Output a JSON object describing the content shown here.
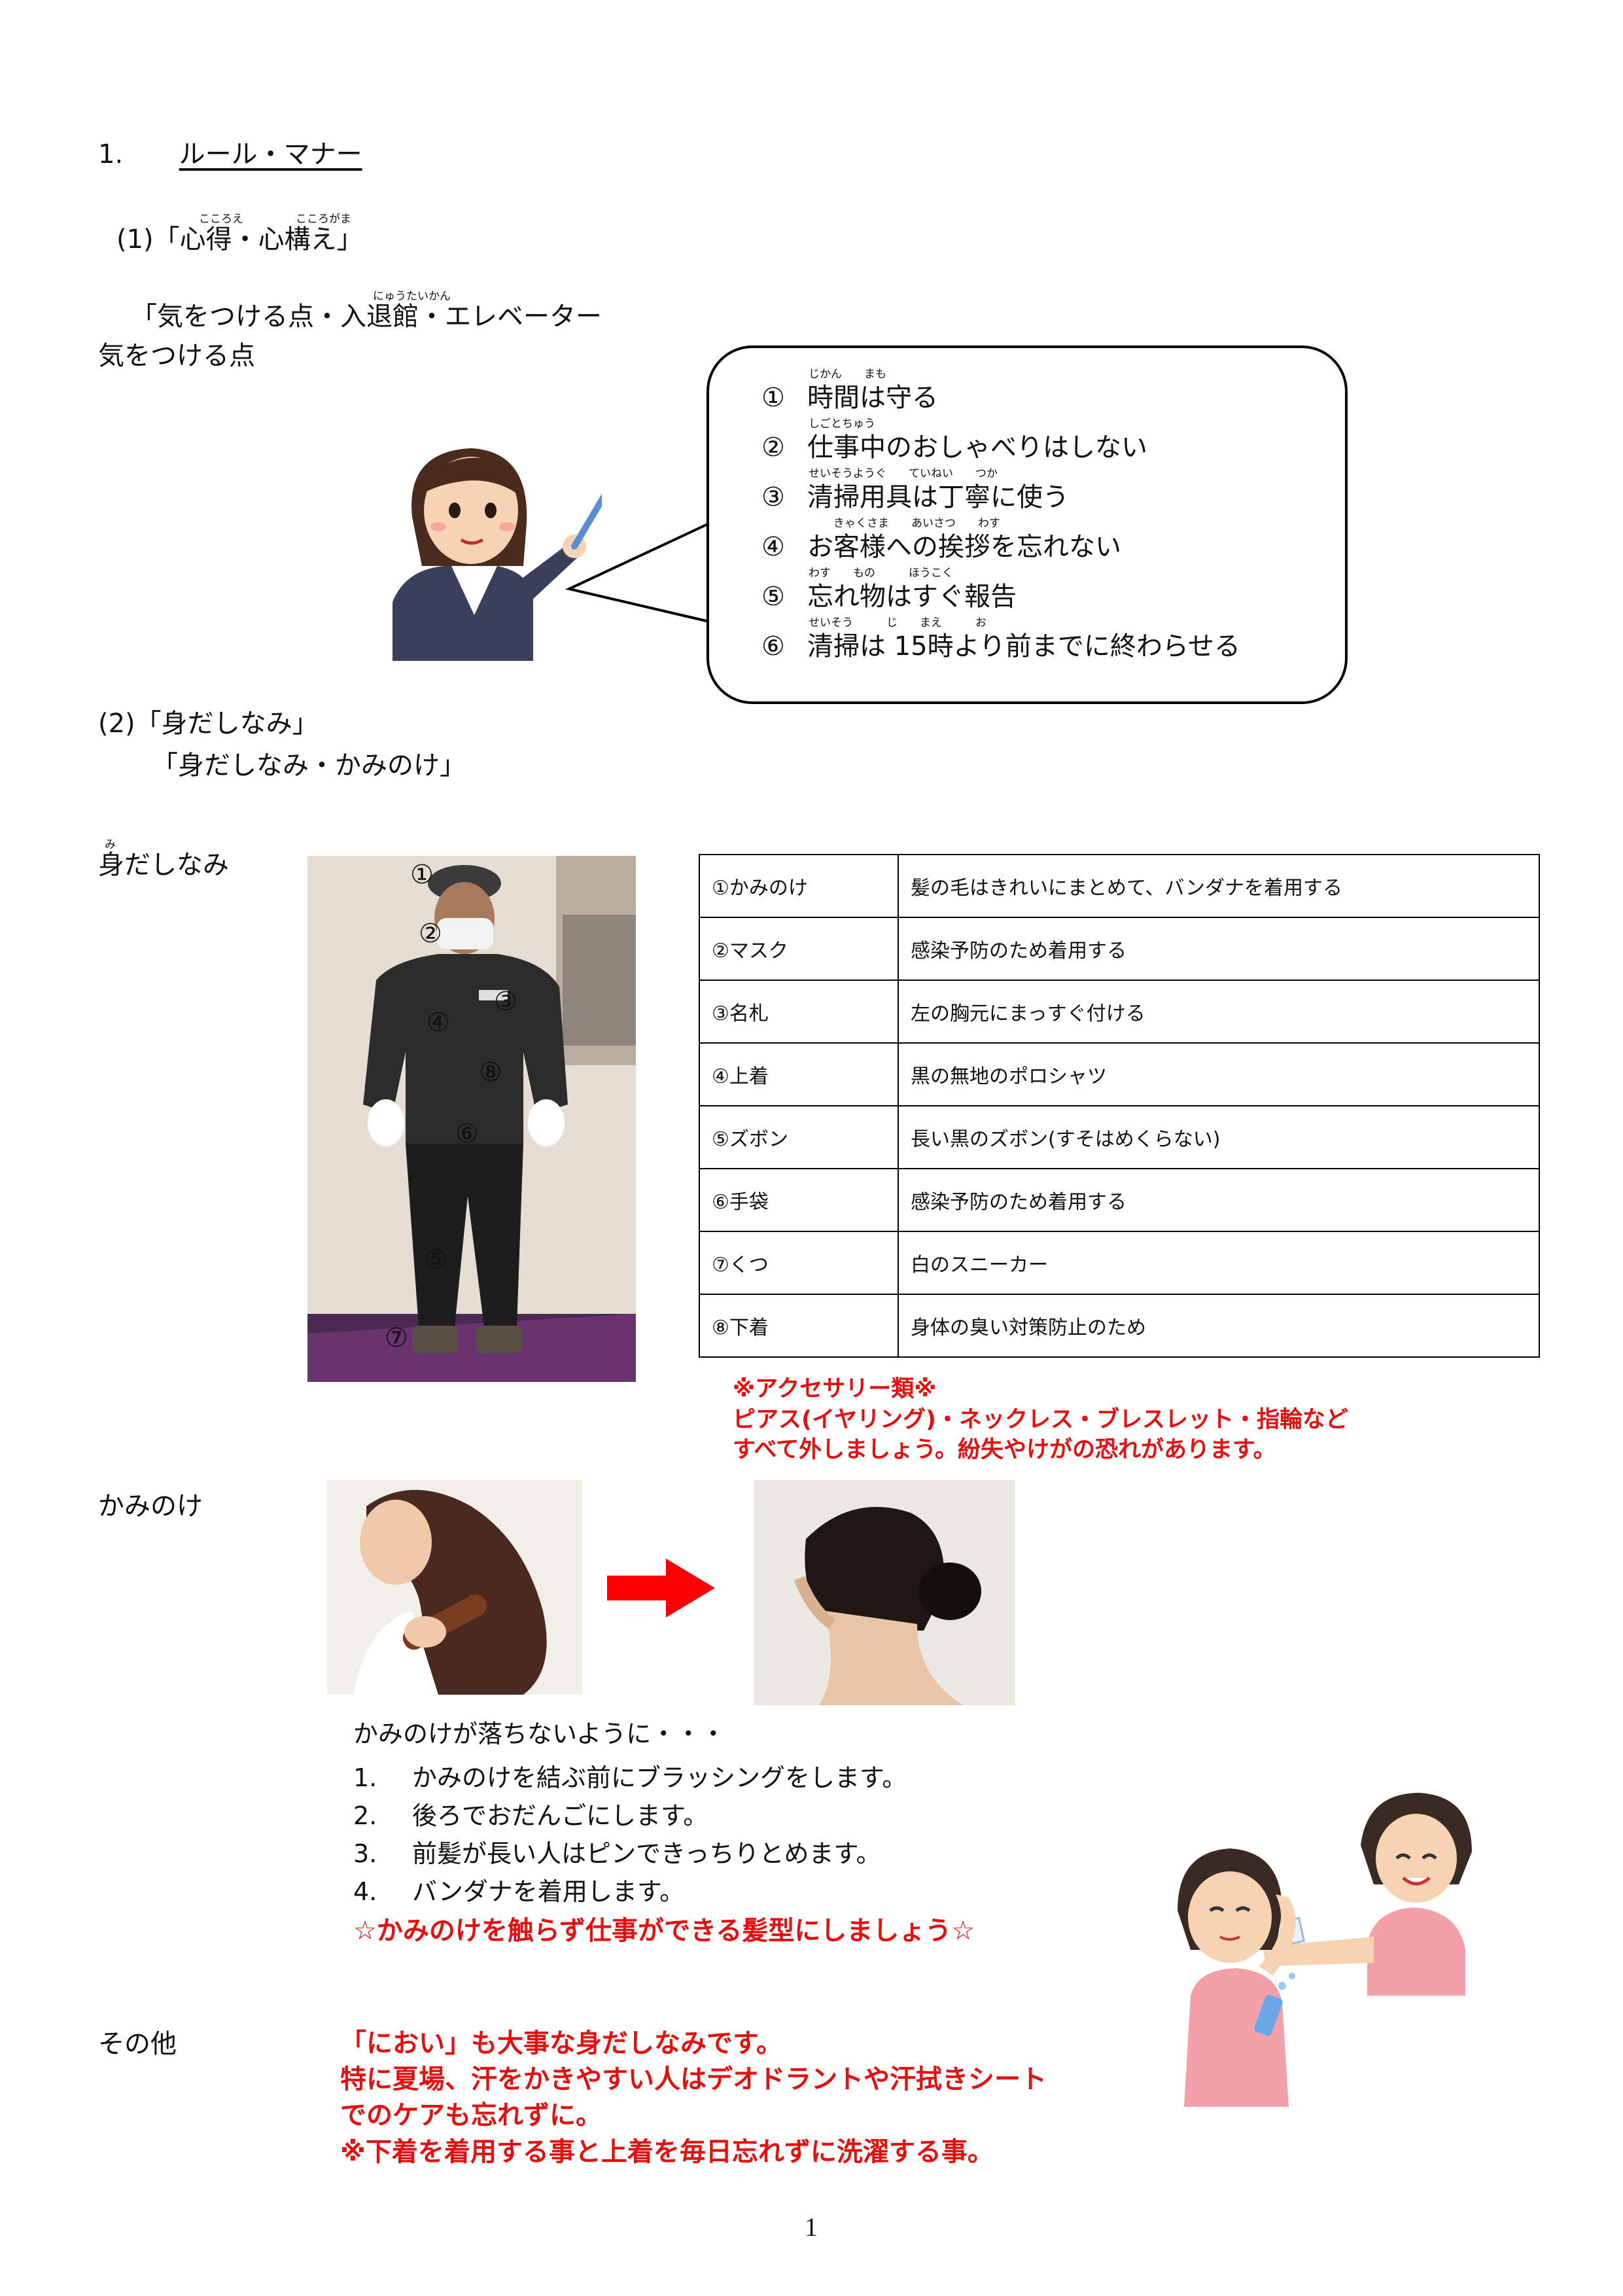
{
  "heading": {
    "num": "1.",
    "title": "ルール・マナー"
  },
  "sec1": {
    "title": "(1)「心得・心構え」",
    "ruby_kokoroe": "こころえ",
    "ruby_kokorogamae": "こころがま",
    "lead_line1": "「気をつける点・入退館・エレベーター",
    "lead_line2": "気をつける点",
    "ruby_nyuutaikan": "にゅうたいかん",
    "bubble_items": [
      {
        "num": "①",
        "text": "時間は守る",
        "ruby": "じかん　　まも"
      },
      {
        "num": "②",
        "text": "仕事中のおしゃべりはしない",
        "ruby": "しごとちゅう"
      },
      {
        "num": "③",
        "text": "清掃用具は丁寧に使う",
        "ruby": "せいそうようぐ　　ていねい　　つか"
      },
      {
        "num": "④",
        "text": "お客様への挨拶を忘れない",
        "ruby": "きゃくさま　　あいさつ　　わす"
      },
      {
        "num": "⑤",
        "text": "忘れ物はすぐ報告",
        "ruby": "わす　　もの　　　ほうこく"
      },
      {
        "num": "⑥",
        "text": "清掃は 15時より前までに終わらせる",
        "ruby": "せいそう　　　じ　　まえ　　　お"
      }
    ]
  },
  "sec2": {
    "title": "(2)「身だしなみ」",
    "subtitle": "「身だしなみ・かみのけ」",
    "label_midashinami": "身だしなみ",
    "ruby_mi": "み",
    "photo_markers": [
      "①",
      "②",
      "③",
      "④",
      "⑧",
      "⑥",
      "⑤",
      "⑦"
    ],
    "table": [
      {
        "item": "①かみのけ",
        "desc": "髪の毛はきれいにまとめて、バンダナを着用する"
      },
      {
        "item": "②マスク",
        "desc": "感染予防のため着用する"
      },
      {
        "item": "③名札",
        "desc": "左の胸元にまっすぐ付ける"
      },
      {
        "item": "④上着",
        "desc": "黒の無地のポロシャツ"
      },
      {
        "item": "⑤ズボン",
        "desc": "長い黒のズボン(すそはめくらない)"
      },
      {
        "item": "⑥手袋",
        "desc": "感染予防のため着用する"
      },
      {
        "item": "⑦くつ",
        "desc": "白のスニーカー"
      },
      {
        "item": "⑧下着",
        "desc": "身体の臭い対策防止のため"
      }
    ],
    "accessory_note": [
      "※アクセサリー類※",
      "ピアス(イヤリング)・ネックレス・ブレスレット・指輪など",
      "すべて外しましょう。紛失やけがの恐れがあります。"
    ]
  },
  "hair": {
    "label": "かみのけ",
    "intro": "かみのけが落ちないように・・・",
    "steps": [
      {
        "n": "1.",
        "text": "かみのけを結ぶ前にブラッシングをします。"
      },
      {
        "n": "2.",
        "text": "後ろでおだんごにします。"
      },
      {
        "n": "3.",
        "text": "前髪が長い人はピンできっちりとめます。"
      },
      {
        "n": "4.",
        "text": "バンダナを着用します。"
      }
    ],
    "highlight": "☆かみのけを触らず仕事ができる髪型にしましょう☆"
  },
  "other": {
    "label": "その他",
    "lines": [
      "「におい」も大事な身だしなみです。",
      "特に夏場、汗をかきやすい人はデオドラントや汗拭きシート",
      "でのケアも忘れずに。",
      "※下着を着用する事と上着を毎日忘れずに洗濯する事。"
    ]
  },
  "page_number": "1",
  "colors": {
    "accent_red": "#e3100f",
    "arrow_red": "#ff0000"
  }
}
